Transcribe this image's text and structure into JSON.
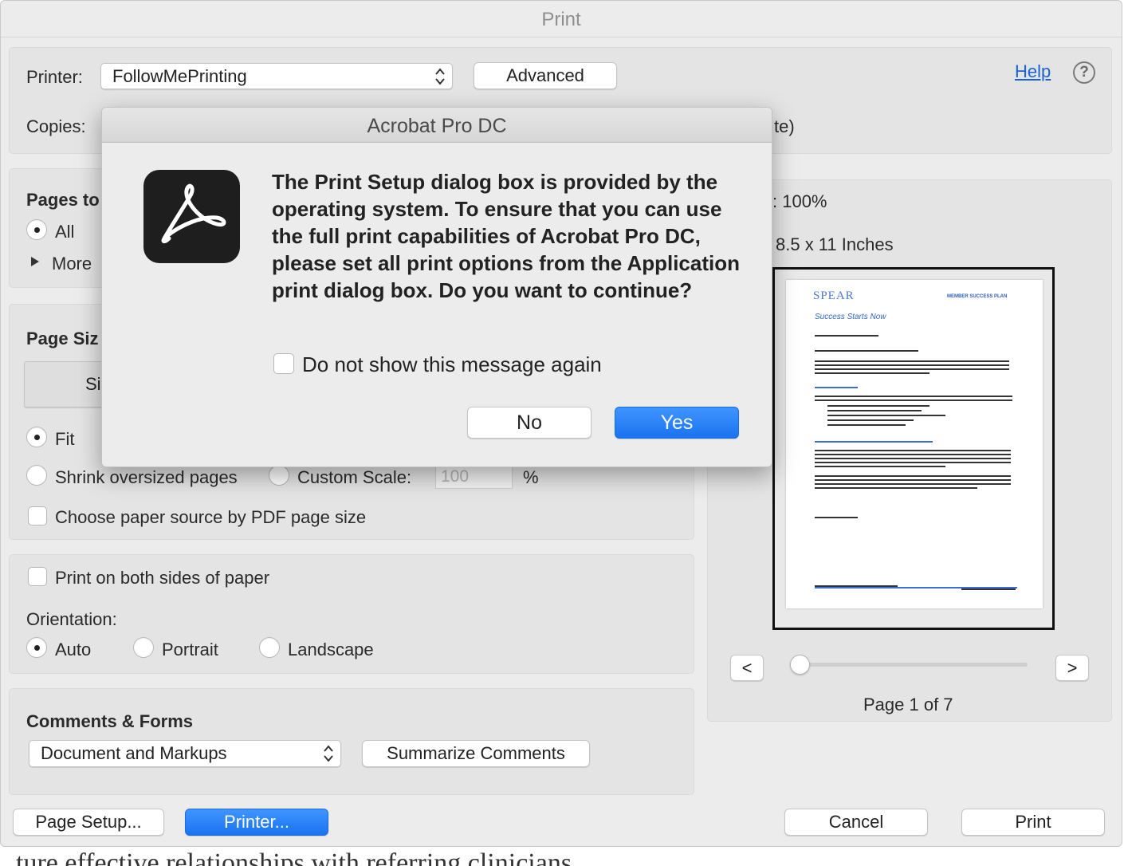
{
  "background": {
    "text": "ture effective relationships with referring clinicians"
  },
  "window": {
    "title": "Print"
  },
  "header": {
    "printer_label": "Printer:",
    "printer_value": "FollowMePrinting",
    "advanced_label": "Advanced",
    "help_label": "Help",
    "copies_label": "Copies:",
    "copies_suffix": "te)"
  },
  "pages": {
    "heading": "Pages to",
    "all_label": "All",
    "more_label": "More"
  },
  "page_size": {
    "heading": "Page Siz",
    "tab_label": "Si",
    "fit_label": "Fit",
    "shrink_label": "Shrink oversized pages",
    "custom_scale_label": "Custom Scale:",
    "custom_scale_value": "100",
    "percent": "%",
    "paper_source_label": "Choose paper source by PDF page size"
  },
  "duplex": {
    "both_sides_label": "Print on both sides of paper",
    "orientation_label": "Orientation:",
    "auto_label": "Auto",
    "portrait_label": "Portrait",
    "landscape_label": "Landscape"
  },
  "comments": {
    "heading": "Comments & Forms",
    "select_value": "Document and Markups",
    "summarize_label": "Summarize Comments"
  },
  "preview": {
    "scale_text": ": 100%",
    "size_text": "8.5 x 11 Inches",
    "prev_label": "<",
    "next_label": ">",
    "page_text": "Page 1 of 7",
    "doc_logo": "SPEAR",
    "doc_header": "MEMBER SUCCESS PLAN",
    "doc_title": "Success Starts Now"
  },
  "footer": {
    "page_setup_label": "Page Setup...",
    "printer_label": "Printer...",
    "cancel_label": "Cancel",
    "print_label": "Print"
  },
  "modal": {
    "title": "Acrobat Pro DC",
    "message": "The Print Setup dialog box is provided by the operating system. To ensure that you can use the full print capabilities of Acrobat Pro DC, please set all print options from the Application print dialog box. Do you want to continue?",
    "checkbox_label": "Do not show this message again",
    "no_label": "No",
    "yes_label": "Yes"
  },
  "colors": {
    "accent": "#1a73f0",
    "link": "#1a62d6",
    "window_bg": "#ececec"
  }
}
